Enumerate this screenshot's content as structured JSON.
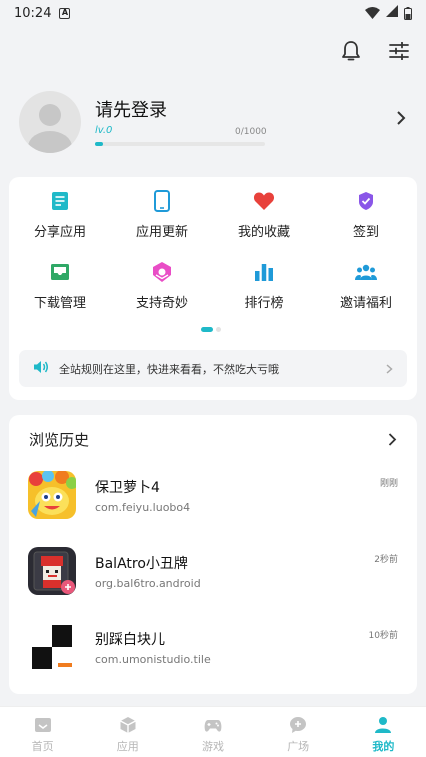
{
  "status_bar": {
    "time": "10:24",
    "notif_badge": "A"
  },
  "colors": {
    "accent": "#1fb9c8",
    "heart": "#e8413b",
    "purple": "#8a56e8",
    "pink": "#e94dc6"
  },
  "top_actions": {
    "bell_icon": "bell-icon",
    "settings_icon": "sliders-icon"
  },
  "profile": {
    "name": "请先登录",
    "level": "lv.0",
    "exp": "0/1000",
    "exp_progress": 0.0
  },
  "grid": [
    {
      "label": "分享应用",
      "icon": "share-app-icon"
    },
    {
      "label": "应用更新",
      "icon": "phone-icon"
    },
    {
      "label": "我的收藏",
      "icon": "heart-icon"
    },
    {
      "label": "签到",
      "icon": "check-badge-icon"
    },
    {
      "label": "下载管理",
      "icon": "inbox-icon"
    },
    {
      "label": "支持奇妙",
      "icon": "gift-icon"
    },
    {
      "label": "排行榜",
      "icon": "bar-chart-icon"
    },
    {
      "label": "邀请福利",
      "icon": "group-icon"
    }
  ],
  "notice": {
    "text": "全站规则在这里，快进来看看，不然吃大亏哦"
  },
  "history": {
    "title": "浏览历史",
    "items": [
      {
        "name": "保卫萝卜4",
        "package": "com.feiyu.luobo4",
        "time": "刚刚"
      },
      {
        "name": "BalAtro小丑牌",
        "package": "org.bal6tro.android",
        "time": "2秒前"
      },
      {
        "name": "别踩白块儿",
        "package": "com.umonistudio.tile",
        "time": "10秒前"
      }
    ]
  },
  "nav": [
    {
      "label": "首页",
      "icon": "home-icon"
    },
    {
      "label": "应用",
      "icon": "cube-icon"
    },
    {
      "label": "游戏",
      "icon": "gamepad-icon"
    },
    {
      "label": "广场",
      "icon": "chat-plus-icon"
    },
    {
      "label": "我的",
      "icon": "user-icon",
      "active": true
    }
  ]
}
